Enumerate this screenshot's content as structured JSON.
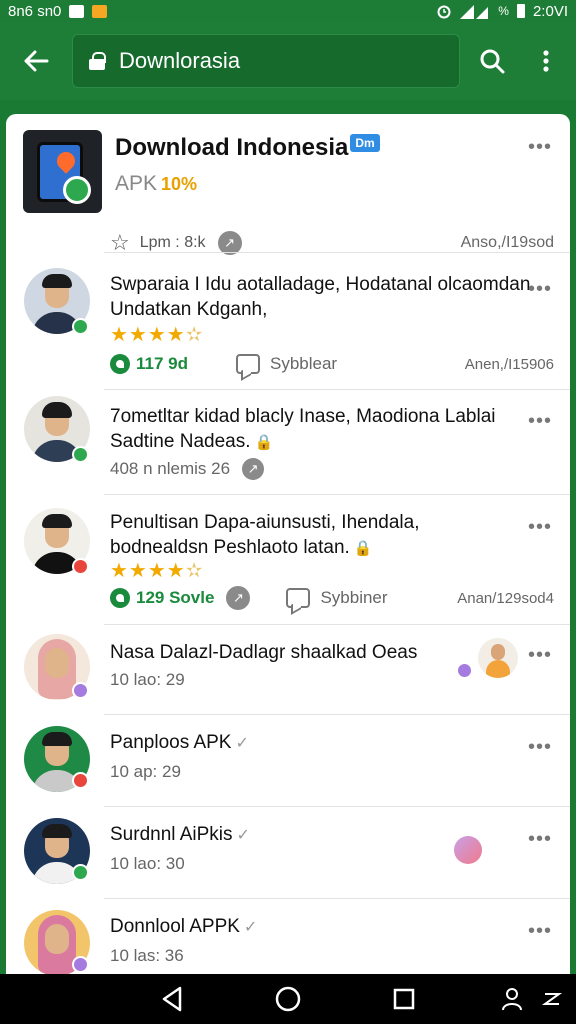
{
  "status_bar": {
    "left_text": "8n6 sn0",
    "battery": "%",
    "time": "2:0VI"
  },
  "toolbar": {
    "url": "Downlorasia"
  },
  "app": {
    "title": "Download Indonesia",
    "tag": "Dm",
    "subtitle": "APK",
    "percent": "10%",
    "meta_left": "Lpm : 8:k",
    "meta_right": "Anso,/I19sod"
  },
  "items": [
    {
      "title_line1": "Swparaia I Idu aotalladage, Hodatanal olcaomdan",
      "title_line2": "Undatkan Kdganh,",
      "rating": 4.5,
      "stars": "★★★★",
      "likes": "117 9d",
      "comment": "Sybblear",
      "date": "Anen,/I15906"
    },
    {
      "title_line1": "7ometltar kidad blacly Inase, Maodiona Lablai",
      "title_line2": "Sadtine Nadeas.",
      "meta": "408 n nlemis 26"
    },
    {
      "title_line1": "Penultisan Dapa-aiunsusti, Ihendala,",
      "title_line2": "bodnealdsn Peshlaoto latan.",
      "rating": 4.5,
      "stars": "★★★★",
      "likes": "129 Sovle",
      "comment": "Sybbiner",
      "date": "Anan/129sod4"
    },
    {
      "title_line1": "Nasa Dalazl-Dadlagr shaalkad Oeas",
      "meta": "10 lao: 29"
    },
    {
      "title_line1": "Panploos APK",
      "meta": "10 ap: 29"
    },
    {
      "title_line1": "Surdnnl AiPkis",
      "meta": "10 lao: 30"
    },
    {
      "title_line1": "Donnlool APPK",
      "meta": "10 las: 36"
    }
  ],
  "colors": {
    "brand_green": "#1e7e37",
    "star": "#f2a900",
    "likes_green": "#1a8a3c"
  },
  "icons": [
    "back-arrow-icon",
    "lock-icon",
    "search-icon",
    "kebab-menu-icon",
    "back-nav-icon",
    "home-nav-icon",
    "recents-nav-icon"
  ]
}
